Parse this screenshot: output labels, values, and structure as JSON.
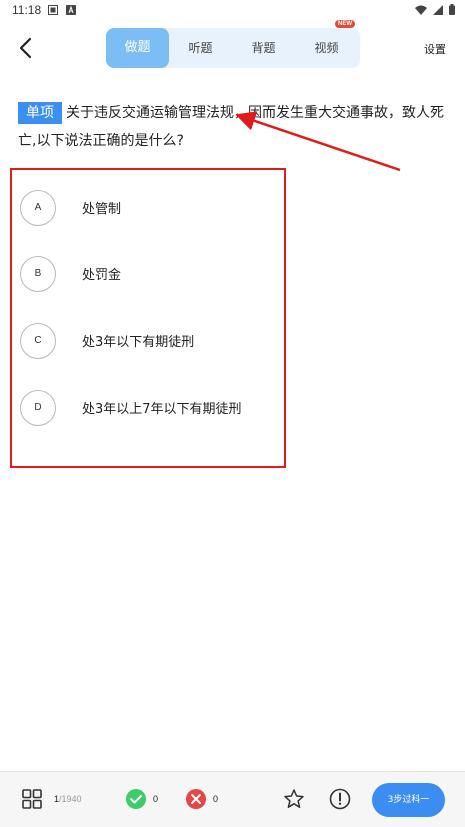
{
  "status": {
    "time": "11:18"
  },
  "tabs": [
    {
      "label": "做题"
    },
    {
      "label": "听题"
    },
    {
      "label": "背题"
    },
    {
      "label": "视频"
    }
  ],
  "new_badge": "NEW",
  "settings_label": "设置",
  "question": {
    "type": "单项",
    "text": "关于违反交通运输管理法规，因而发生重大交通事故，致人死亡,以下说法正确的是什么?"
  },
  "options": [
    {
      "key": "A",
      "text": "处管制"
    },
    {
      "key": "B",
      "text": "处罚金"
    },
    {
      "key": "C",
      "text": "处3年以下有期徒刑"
    },
    {
      "key": "D",
      "text": "处3年以上7年以下有期徒刑"
    }
  ],
  "bottom": {
    "current": "1",
    "total": "/1940",
    "correct_count": "0",
    "wrong_count": "0",
    "next_label": "3步过科一"
  },
  "colors": {
    "accent": "#3b8df1",
    "tab_active": "#7cbdf6",
    "tab_bg": "#e8f2fd",
    "annotation_red": "#e11b1b",
    "correct_green": "#3fca6b",
    "wrong_red": "#e84545"
  }
}
